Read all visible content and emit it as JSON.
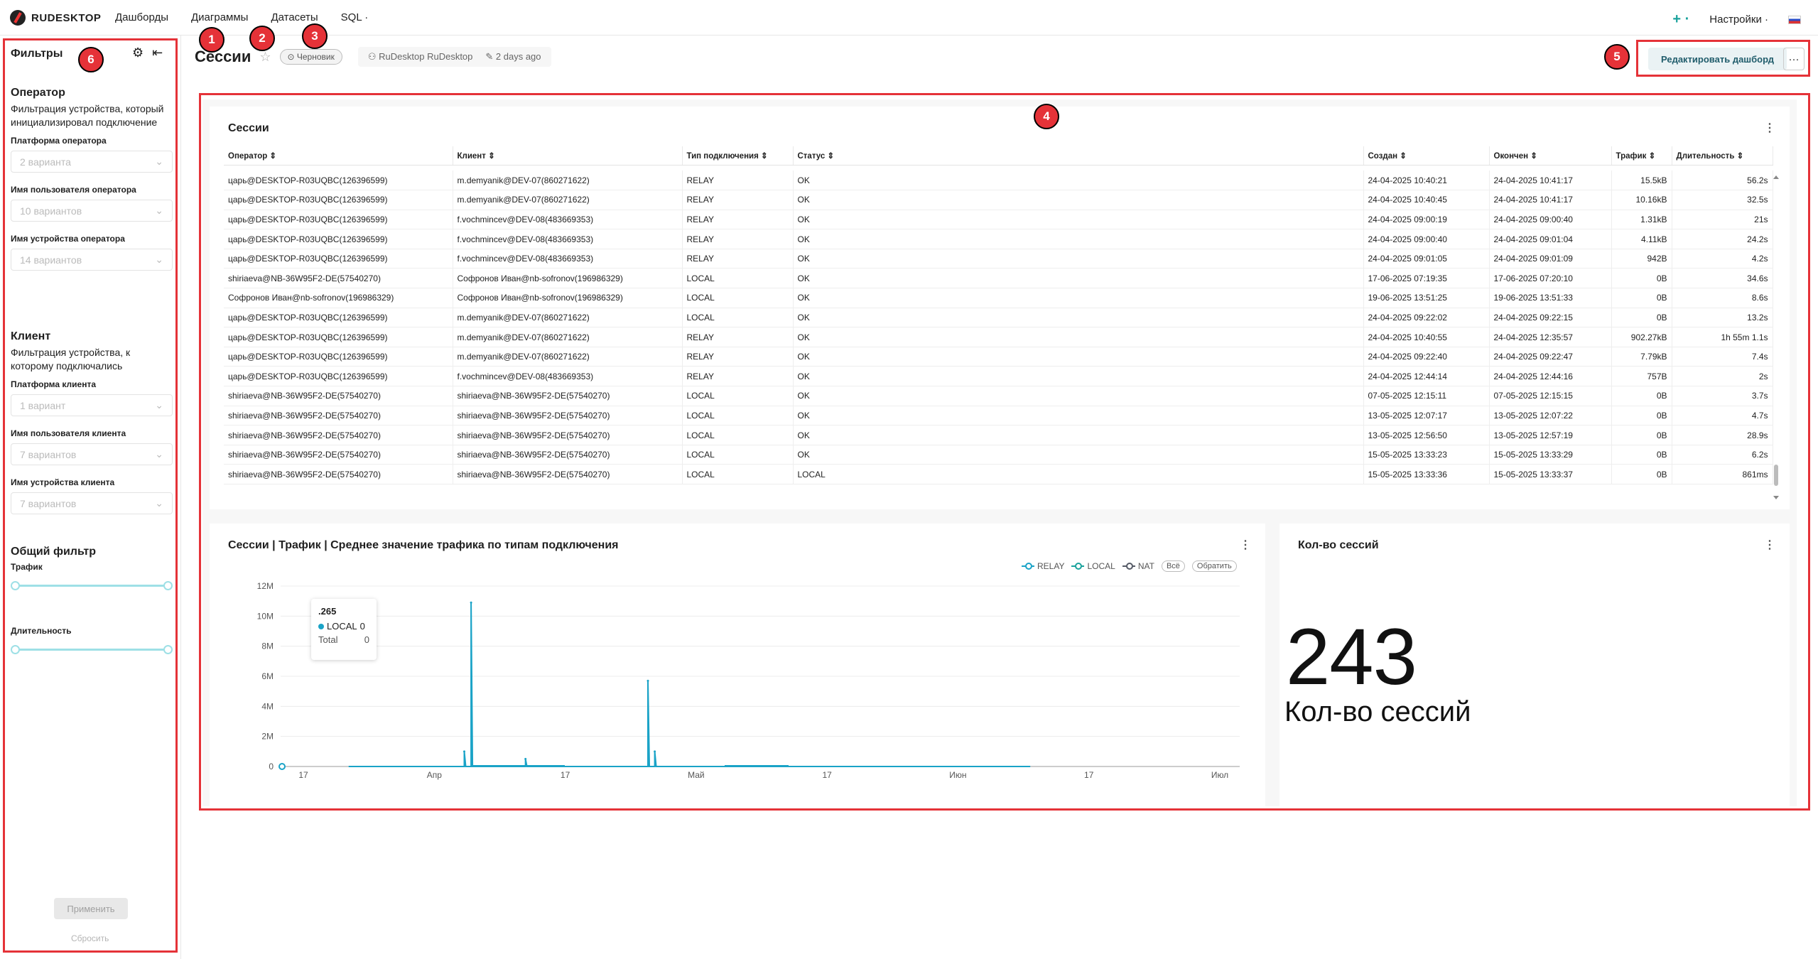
{
  "app": {
    "logo_text": "RUDESKTOP"
  },
  "nav": {
    "items": [
      "Дашборды",
      "Диаграммы",
      "Датасеты",
      "SQL ·"
    ]
  },
  "topright": {
    "plus": "+ ·",
    "settings": "Настройки ·"
  },
  "page": {
    "title": "Сессии",
    "badge": "⊙ Черновик",
    "author": "RuDesktop RuDesktop",
    "modified": "2 days ago",
    "edit_button": "Редактировать дашборд",
    "more_button": "···"
  },
  "sidebar": {
    "title": "Фильтры",
    "operator": {
      "heading": "Оператор",
      "desc": "Фильтрация устройства, который инициализировал подключение",
      "fields": [
        {
          "label": "Платформа оператора",
          "value": "2 варианта"
        },
        {
          "label": "Имя пользователя оператора",
          "value": "10 вариантов"
        },
        {
          "label": "Имя устройства оператора",
          "value": "14 вариантов"
        }
      ]
    },
    "client": {
      "heading": "Клиент",
      "desc": "Фильтрация устройства, к которому подключались",
      "fields": [
        {
          "label": "Платформа клиента",
          "value": "1 вариант"
        },
        {
          "label": "Имя пользователя клиента",
          "value": "7 вариантов"
        },
        {
          "label": "Имя устройства клиента",
          "value": "7 вариантов"
        }
      ]
    },
    "general": {
      "heading": "Общий фильтр",
      "traffic_label": "Трафик",
      "duration_label": "Длительность"
    },
    "apply": "Применить",
    "reset": "Сбросить"
  },
  "sessions_table": {
    "title": "Сессии",
    "columns": [
      "Оператор ⇕",
      "Клиент ⇕",
      "Тип подключения ⇕",
      "Статус ⇕",
      "Создан ⇕",
      "Окончен ⇕",
      "Трафик ⇕",
      "Длительность ⇕"
    ],
    "rows": [
      [
        "царь@DESKTOP-R03UQBC(126396599)",
        "m.demyanik@DEV-07(860271622)",
        "RELAY",
        "OK",
        "24-04-2025 10:40:21",
        "24-04-2025 10:41:17",
        "15.5kB",
        "56.2s"
      ],
      [
        "царь@DESKTOP-R03UQBC(126396599)",
        "m.demyanik@DEV-07(860271622)",
        "RELAY",
        "OK",
        "24-04-2025 10:40:45",
        "24-04-2025 10:41:17",
        "10.16kB",
        "32.5s"
      ],
      [
        "царь@DESKTOP-R03UQBC(126396599)",
        "f.vochmincev@DEV-08(483669353)",
        "RELAY",
        "OK",
        "24-04-2025 09:00:19",
        "24-04-2025 09:00:40",
        "1.31kB",
        "21s"
      ],
      [
        "царь@DESKTOP-R03UQBC(126396599)",
        "f.vochmincev@DEV-08(483669353)",
        "RELAY",
        "OK",
        "24-04-2025 09:00:40",
        "24-04-2025 09:01:04",
        "4.11kB",
        "24.2s"
      ],
      [
        "царь@DESKTOP-R03UQBC(126396599)",
        "f.vochmincev@DEV-08(483669353)",
        "RELAY",
        "OK",
        "24-04-2025 09:01:05",
        "24-04-2025 09:01:09",
        "942B",
        "4.2s"
      ],
      [
        "shiriaeva@NB-36W95F2-DE(57540270)",
        "Софронов Иван@nb-sofronov(196986329)",
        "LOCAL",
        "OK",
        "17-06-2025 07:19:35",
        "17-06-2025 07:20:10",
        "0B",
        "34.6s"
      ],
      [
        "Софронов Иван@nb-sofronov(196986329)",
        "Софронов Иван@nb-sofronov(196986329)",
        "LOCAL",
        "OK",
        "19-06-2025 13:51:25",
        "19-06-2025 13:51:33",
        "0B",
        "8.6s"
      ],
      [
        "царь@DESKTOP-R03UQBC(126396599)",
        "m.demyanik@DEV-07(860271622)",
        "LOCAL",
        "OK",
        "24-04-2025 09:22:02",
        "24-04-2025 09:22:15",
        "0B",
        "13.2s"
      ],
      [
        "царь@DESKTOP-R03UQBC(126396599)",
        "m.demyanik@DEV-07(860271622)",
        "RELAY",
        "OK",
        "24-04-2025 10:40:55",
        "24-04-2025 12:35:57",
        "902.27kB",
        "1h 55m 1.1s"
      ],
      [
        "царь@DESKTOP-R03UQBC(126396599)",
        "m.demyanik@DEV-07(860271622)",
        "RELAY",
        "OK",
        "24-04-2025 09:22:40",
        "24-04-2025 09:22:47",
        "7.79kB",
        "7.4s"
      ],
      [
        "царь@DESKTOP-R03UQBC(126396599)",
        "f.vochmincev@DEV-08(483669353)",
        "RELAY",
        "OK",
        "24-04-2025 12:44:14",
        "24-04-2025 12:44:16",
        "757B",
        "2s"
      ],
      [
        "shiriaeva@NB-36W95F2-DE(57540270)",
        "shiriaeva@NB-36W95F2-DE(57540270)",
        "LOCAL",
        "OK",
        "07-05-2025 12:15:11",
        "07-05-2025 12:15:15",
        "0B",
        "3.7s"
      ],
      [
        "shiriaeva@NB-36W95F2-DE(57540270)",
        "shiriaeva@NB-36W95F2-DE(57540270)",
        "LOCAL",
        "OK",
        "13-05-2025 12:07:17",
        "13-05-2025 12:07:22",
        "0B",
        "4.7s"
      ],
      [
        "shiriaeva@NB-36W95F2-DE(57540270)",
        "shiriaeva@NB-36W95F2-DE(57540270)",
        "LOCAL",
        "OK",
        "13-05-2025 12:56:50",
        "13-05-2025 12:57:19",
        "0B",
        "28.9s"
      ],
      [
        "shiriaeva@NB-36W95F2-DE(57540270)",
        "shiriaeva@NB-36W95F2-DE(57540270)",
        "LOCAL",
        "OK",
        "15-05-2025 13:33:23",
        "15-05-2025 13:33:29",
        "0B",
        "6.2s"
      ],
      [
        "shiriaeva@NB-36W95F2-DE(57540270)",
        "shiriaeva@NB-36W95F2-DE(57540270)",
        "LOCAL",
        "LOCAL",
        "15-05-2025 13:33:36",
        "15-05-2025 13:33:37",
        "0B",
        "861ms"
      ]
    ]
  },
  "traffic_chart": {
    "title": "Сессии | Трафик | Среднее значение трафика по типам подключения",
    "legend": [
      {
        "name": "RELAY",
        "color": "#1aa3c7"
      },
      {
        "name": "LOCAL",
        "color": "#1aa29c"
      },
      {
        "name": "NAT",
        "color": "#555a66"
      }
    ],
    "buttons": [
      "Всё",
      "Обратить"
    ],
    "tooltip": {
      "title": ".265",
      "series": "LOCAL",
      "series_value": "0",
      "total_label": "Total",
      "total_value": "0"
    }
  },
  "chart_data": {
    "type": "line",
    "x": [
      "2025-03-11",
      "2025-03-28",
      "2025-03-29",
      "2025-04-06",
      "2025-04-24",
      "2025-04-25",
      "2025-05-13",
      "2025-06-17",
      "2025-06-19"
    ],
    "series": [
      {
        "name": "RELAY",
        "values": [
          0,
          1000000,
          10900000,
          500000,
          5700000,
          1000000,
          0,
          0,
          0
        ]
      }
    ],
    "x_ticks": [
      "17",
      "Апр",
      "17",
      "Май",
      "17",
      "Июн",
      "17",
      "Июл"
    ],
    "y_ticks": [
      "0",
      "2M",
      "4M",
      "6M",
      "8M",
      "10M",
      "12M"
    ],
    "ylim": [
      0,
      12000000
    ],
    "grid": true,
    "legend_position": "top-right"
  },
  "count_card": {
    "title": "Кол-во сессий",
    "value": "243",
    "subtitle": "Кол-во сессий"
  },
  "markers": [
    "1",
    "2",
    "3",
    "4",
    "5",
    "6"
  ],
  "colors": {
    "accent": "#1aa29c",
    "annotation": "#e53238"
  }
}
